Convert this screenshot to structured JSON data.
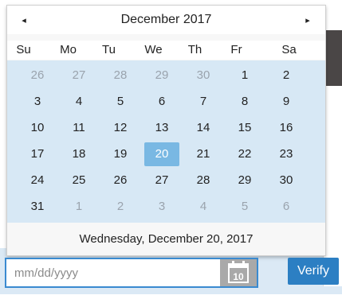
{
  "datepicker": {
    "month_title": "December 2017",
    "prev_glyph": "◂",
    "next_glyph": "▸",
    "weekdays": [
      "Su",
      "Mo",
      "Tu",
      "We",
      "Th",
      "Fr",
      "Sa"
    ],
    "weeks": [
      [
        "26",
        "27",
        "28",
        "29",
        "30",
        "1",
        "2"
      ],
      [
        "3",
        "4",
        "5",
        "6",
        "7",
        "8",
        "9"
      ],
      [
        "10",
        "11",
        "12",
        "13",
        "14",
        "15",
        "16"
      ],
      [
        "17",
        "18",
        "19",
        "20",
        "21",
        "22",
        "23"
      ],
      [
        "24",
        "25",
        "26",
        "27",
        "28",
        "29",
        "30"
      ],
      [
        "31",
        "1",
        "2",
        "3",
        "4",
        "5",
        "6"
      ]
    ],
    "selected_day": "20",
    "footer_text": "Wednesday, December 20, 2017"
  },
  "date_field": {
    "placeholder": "mm/dd/yyyy",
    "value": "",
    "calendar_icon_day": "10"
  },
  "verify_label": "Verify",
  "colors": {
    "accent": "#2c7fc3",
    "selected_day_bg": "#79b8e3",
    "grid_bg": "#d7e8f5"
  }
}
